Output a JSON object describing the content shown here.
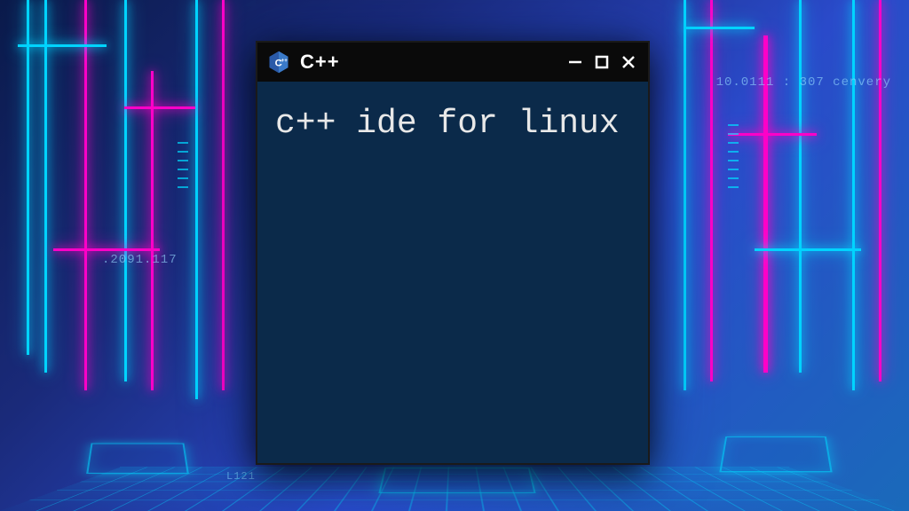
{
  "window": {
    "title": "C++",
    "icon_name": "cpp-logo-icon"
  },
  "terminal": {
    "content": "c++ ide for linux"
  },
  "background": {
    "decorative_text_1": "10.0111 : 307  cenvery",
    "decorative_text_2": ".2091.117",
    "decorative_text_3": "L121"
  }
}
